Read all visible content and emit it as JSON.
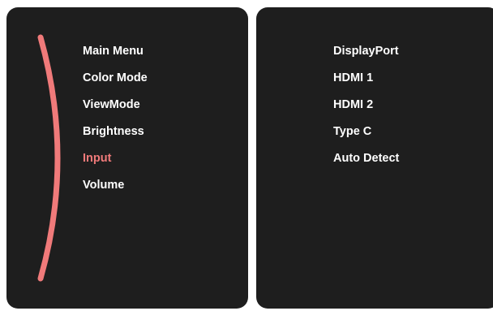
{
  "accent_color": "#f07a7a",
  "panel_color": "#1e1e1e",
  "main_menu": {
    "items": [
      {
        "label": "Main Menu",
        "active": false
      },
      {
        "label": "Color Mode",
        "active": false
      },
      {
        "label": "ViewMode",
        "active": false
      },
      {
        "label": "Brightness",
        "active": false
      },
      {
        "label": "Input",
        "active": true
      },
      {
        "label": "Volume",
        "active": false
      }
    ]
  },
  "submenu": {
    "items": [
      {
        "label": "DisplayPort"
      },
      {
        "label": "HDMI 1"
      },
      {
        "label": "HDMI 2"
      },
      {
        "label": "Type C"
      },
      {
        "label": "Auto Detect"
      }
    ]
  }
}
